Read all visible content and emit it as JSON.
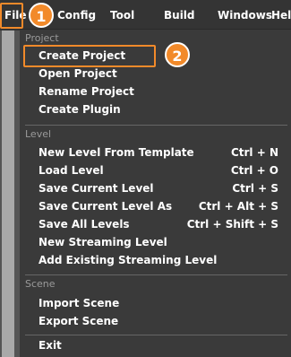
{
  "menubar": {
    "file": "File",
    "config": "Config",
    "tool": "Tool",
    "build": "Build",
    "windows": "Windows",
    "help": "Help"
  },
  "badges": {
    "one": "1",
    "two": "2"
  },
  "project": {
    "label": "Project",
    "items": [
      {
        "label": "Create Project",
        "shortcut": ""
      },
      {
        "label": "Open Project",
        "shortcut": ""
      },
      {
        "label": "Rename Project",
        "shortcut": ""
      },
      {
        "label": "Create Plugin",
        "shortcut": ""
      }
    ]
  },
  "level": {
    "label": "Level",
    "items": [
      {
        "label": "New Level From Template",
        "shortcut": "Ctrl + N"
      },
      {
        "label": "Load Level",
        "shortcut": "Ctrl + O"
      },
      {
        "label": "Save Current Level",
        "shortcut": "Ctrl + S"
      },
      {
        "label": "Save Current Level As",
        "shortcut": "Ctrl + Alt + S"
      },
      {
        "label": "Save All Levels",
        "shortcut": "Ctrl + Shift + S"
      },
      {
        "label": "New Streaming Level",
        "shortcut": ""
      },
      {
        "label": "Add Existing Streaming Level",
        "shortcut": ""
      }
    ]
  },
  "scene": {
    "label": "Scene",
    "items": [
      {
        "label": "Import Scene",
        "shortcut": ""
      },
      {
        "label": "Export Scene",
        "shortcut": ""
      }
    ]
  },
  "exit": {
    "label": "Exit"
  },
  "colors": {
    "accent": "#f28a2a",
    "menu_bg": "#3a3a3a",
    "text": "#ffffff",
    "section_text": "#9a9a9a"
  }
}
